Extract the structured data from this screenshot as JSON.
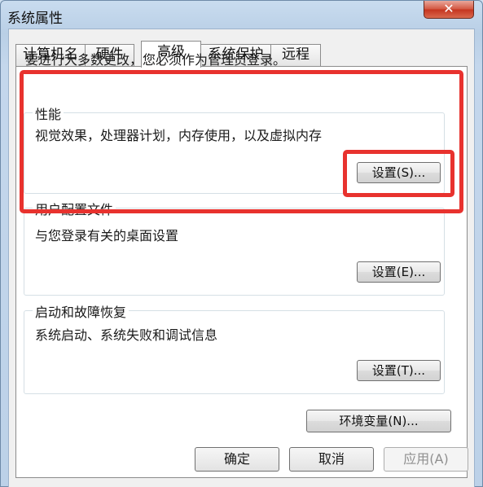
{
  "window": {
    "title": "系统属性",
    "close_glyph": "✕"
  },
  "tabs": [
    {
      "label": "计算机名",
      "active": false
    },
    {
      "label": "硬件",
      "active": false
    },
    {
      "label": "高级",
      "active": true
    },
    {
      "label": "系统保护",
      "active": false
    },
    {
      "label": "远程",
      "active": false
    }
  ],
  "advanced": {
    "admin_note": "要进行大多数更改，您必须作为管理员登录。",
    "performance": {
      "title": "性能",
      "description": "视觉效果，处理器计划，内存使用，以及虚拟内存",
      "button_label": "设置(S)..."
    },
    "user_profiles": {
      "title": "用户配置文件",
      "description": "与您登录有关的桌面设置",
      "button_label": "设置(E)..."
    },
    "startup_recovery": {
      "title": "启动和故障恢复",
      "description": "系统启动、系统失败和调试信息",
      "button_label": "设置(T)..."
    },
    "env_button_label": "环境变量(N)..."
  },
  "footer": {
    "ok_label": "确定",
    "cancel_label": "取消",
    "apply_label": "应用(A)"
  },
  "colors": {
    "highlight": "#e8322e"
  }
}
